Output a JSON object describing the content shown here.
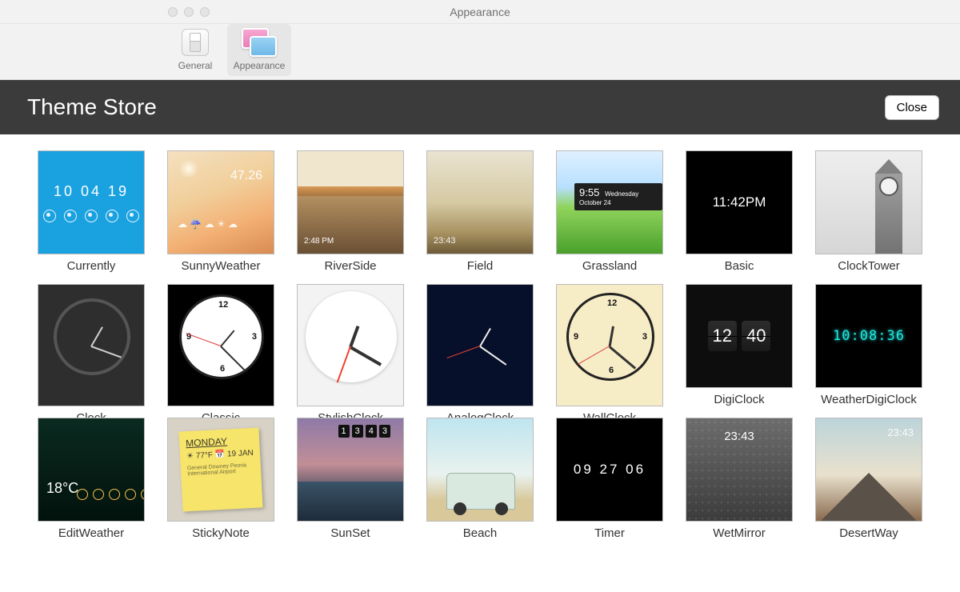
{
  "window": {
    "title": "Appearance"
  },
  "toolbar": {
    "general": "General",
    "appearance": "Appearance"
  },
  "store": {
    "title": "Theme Store",
    "close": "Close"
  },
  "themes": [
    {
      "name": "Currently",
      "time": "10 04 19"
    },
    {
      "name": "SunnyWeather",
      "temp": "47.26"
    },
    {
      "name": "RiverSide",
      "time": "2:48 PM"
    },
    {
      "name": "Field",
      "time": "23:43"
    },
    {
      "name": "Grassland",
      "time": "9:55",
      "date": "Wednesday October 24"
    },
    {
      "name": "Basic",
      "time": "11:42PM"
    },
    {
      "name": "ClockTower"
    },
    {
      "name": "Clock"
    },
    {
      "name": "Classic"
    },
    {
      "name": "StylishClock"
    },
    {
      "name": "AnalogClock"
    },
    {
      "name": "WallClock"
    },
    {
      "name": "DigiClock",
      "hh": "12",
      "mm": "40"
    },
    {
      "name": "WeatherDigiClock",
      "time": "10:08:36"
    },
    {
      "name": "EditWeather",
      "temp": "18°C"
    },
    {
      "name": "StickyNote",
      "day": "MONDAY",
      "temp": "77°F",
      "date": "19 JAN"
    },
    {
      "name": "SunSet",
      "d1": "1",
      "d2": "3",
      "d3": "4",
      "d4": "3"
    },
    {
      "name": "Beach"
    },
    {
      "name": "Timer",
      "time": "09 27 06"
    },
    {
      "name": "WetMirror",
      "time": "23:43"
    },
    {
      "name": "DesertWay",
      "time": "23:43"
    }
  ]
}
